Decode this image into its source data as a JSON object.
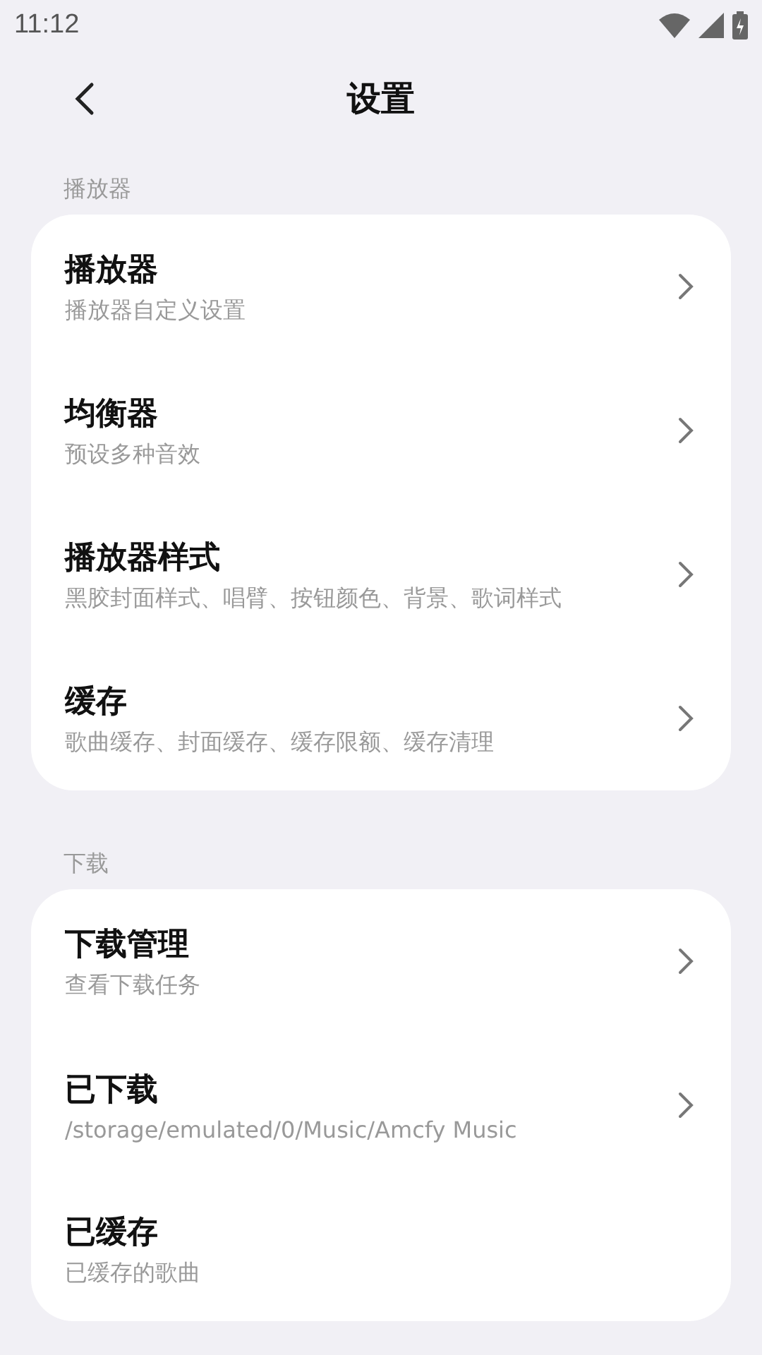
{
  "status_bar": {
    "time": "11:12"
  },
  "header": {
    "title": "设置"
  },
  "sections": [
    {
      "label": "播放器",
      "items": [
        {
          "title": "播放器",
          "subtitle": "播放器自定义设置",
          "chevron": true
        },
        {
          "title": "均衡器",
          "subtitle": "预设多种音效",
          "chevron": true
        },
        {
          "title": "播放器样式",
          "subtitle": "黑胶封面样式、唱臂、按钮颜色、背景、歌词样式",
          "chevron": true
        },
        {
          "title": "缓存",
          "subtitle": "歌曲缓存、封面缓存、缓存限额、缓存清理",
          "chevron": true
        }
      ]
    },
    {
      "label": "下载",
      "items": [
        {
          "title": "下载管理",
          "subtitle": "查看下载任务",
          "chevron": true
        },
        {
          "title": "已下载",
          "subtitle": "/storage/emulated/0/Music/Amcfy Music",
          "chevron": true
        },
        {
          "title": "已缓存",
          "subtitle": "已缓存的歌曲",
          "chevron": false
        }
      ]
    }
  ]
}
